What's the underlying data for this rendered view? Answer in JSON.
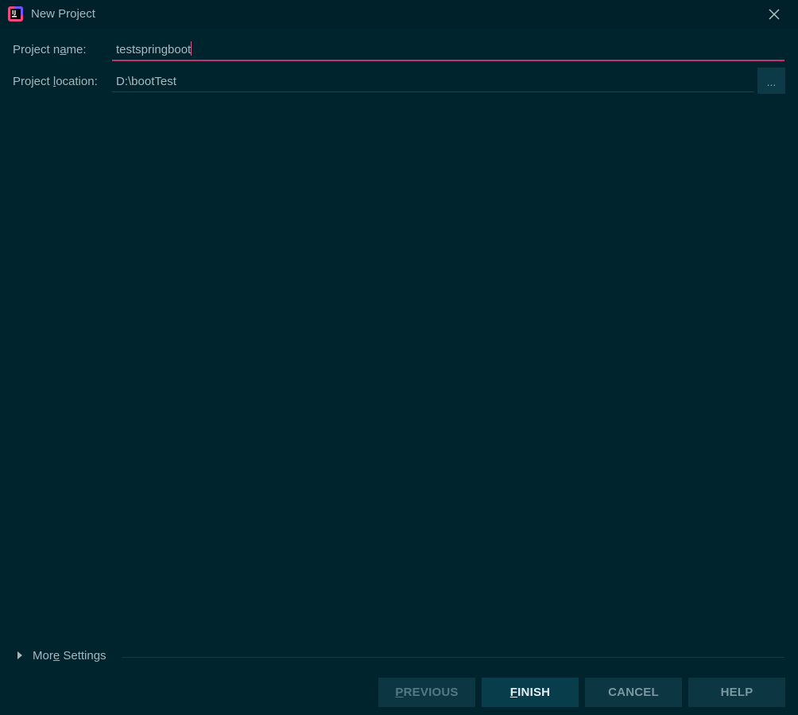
{
  "window": {
    "title": "New Project",
    "icon": "intellij-idea-icon",
    "close_icon": "close-icon"
  },
  "form": {
    "name_label_pre": "Project n",
    "name_label_mnemonic": "a",
    "name_label_post": "me:",
    "name_value": "testspringboot",
    "location_label_pre": "Project ",
    "location_label_mnemonic": "l",
    "location_label_post": "ocation:",
    "location_value": "D:\\bootTest",
    "browse_label": "..."
  },
  "more_settings": {
    "label_pre": "Mor",
    "label_mnemonic": "e",
    "label_post": " Settings",
    "expanded": false
  },
  "buttons": {
    "previous_mnemonic": "P",
    "previous_rest": "REVIOUS",
    "finish_mnemonic": "F",
    "finish_rest": "INISH",
    "cancel": "CANCEL",
    "help": "HELP"
  },
  "colors": {
    "background": "#00242e",
    "accent_focus": "#c5336d",
    "button_primary_text": "#e6eef1",
    "button_disabled_text": "#547985"
  }
}
